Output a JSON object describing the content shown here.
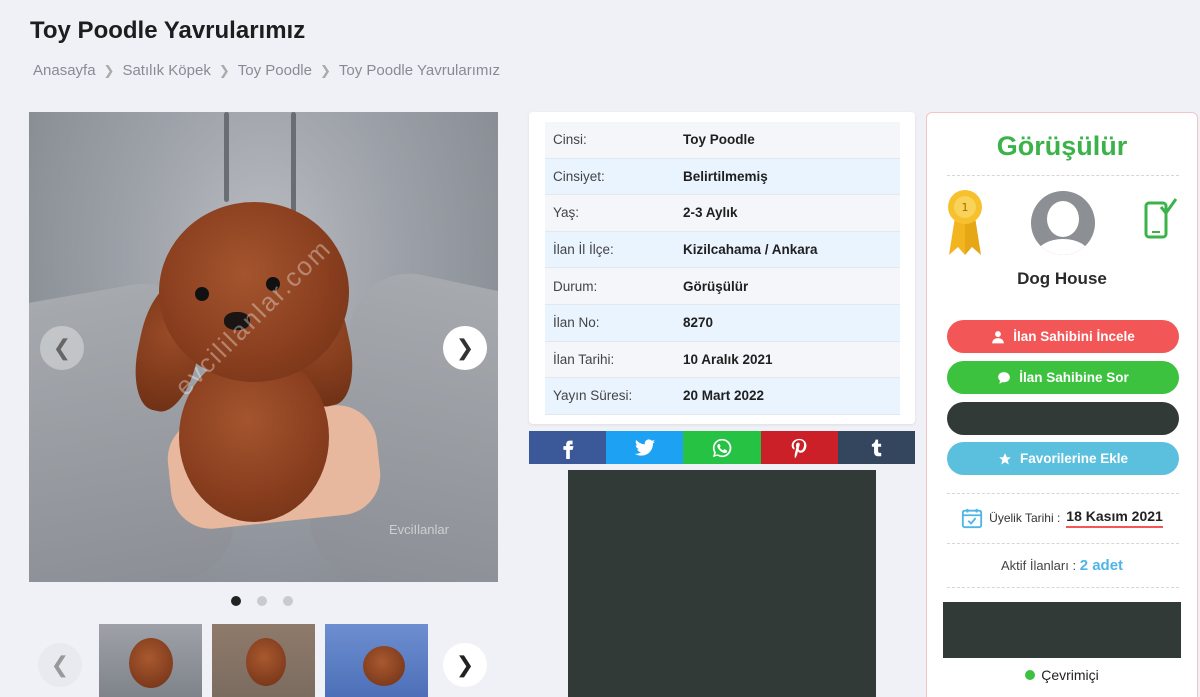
{
  "page": {
    "title": "Toy Poodle Yavrularımız"
  },
  "breadcrumb": [
    "Anasayfa",
    "Satılık Köpek",
    "Toy Poodle",
    "Toy Poodle Yavrularımız"
  ],
  "gallery": {
    "watermark": "evcililanlar.com",
    "watermark_logo": "EvciIlanlar",
    "slide_count": 3,
    "active_slide": 1
  },
  "info": {
    "rows": [
      {
        "key": "Cinsi:",
        "value": "Toy Poodle"
      },
      {
        "key": "Cinsiyet:",
        "value": "Belirtilmemiş"
      },
      {
        "key": "Yaş:",
        "value": "2-3 Aylık"
      },
      {
        "key": "İlan İl İlçe:",
        "value": "Kizilcahama / Ankara"
      },
      {
        "key": "Durum:",
        "value": "Görüşülür"
      },
      {
        "key": "İlan No:",
        "value": "8270"
      },
      {
        "key": "İlan Tarihi:",
        "value": "10 Aralık 2021"
      },
      {
        "key": "Yayın Süresi:",
        "value": "20 Mart 2022"
      }
    ]
  },
  "share": [
    {
      "network": "facebook-icon",
      "color": "#3b5998"
    },
    {
      "network": "twitter-icon",
      "color": "#1da1f2"
    },
    {
      "network": "whatsapp-icon",
      "color": "#25c244"
    },
    {
      "network": "pinterest-icon",
      "color": "#cb2027"
    },
    {
      "network": "tumblr-icon",
      "color": "#34465d"
    }
  ],
  "seller": {
    "status": "Görüşülür",
    "badge_number": "1",
    "name": "Dog House",
    "buttons": {
      "inspect": "İlan Sahibini İncele",
      "ask": "İlan Sahibine Sor",
      "favorite": "Favorilerine Ekle"
    },
    "member_label": "Üyelik Tarihi :",
    "member_date": "18 Kasım 2021",
    "active_label": "Aktif İlanları :",
    "active_count": "2 adet",
    "online": "Çevrimiçi"
  },
  "colors": {
    "status_green": "#3cb34a",
    "red": "#f25656",
    "green": "#3cc23f",
    "blue": "#5bc0de",
    "dark": "#323a38"
  }
}
